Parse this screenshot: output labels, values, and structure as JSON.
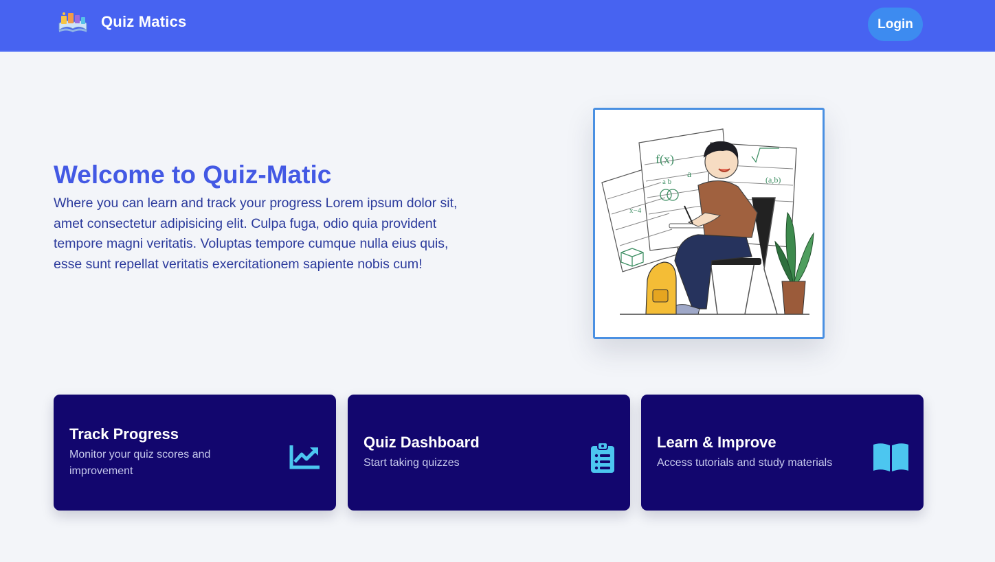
{
  "navbar": {
    "brand_name": "Quiz Matics",
    "login_label": "Login"
  },
  "hero": {
    "title": "Welcome to Quiz-Matic",
    "description": "Where you can learn and track your progress Lorem ipsum dolor sit, amet consectetur adipisicing elit. Culpa fuga, odio quia provident tempore magni veritatis. Voluptas tempore cumque nulla eius quis, esse sunt repellat veritatis exercitationem sapiente nobis cum!"
  },
  "cards": [
    {
      "title": "Track Progress",
      "description": "Monitor your quiz scores and improvement",
      "icon": "chart-line-icon"
    },
    {
      "title": "Quiz Dashboard",
      "description": "Start taking quizzes",
      "icon": "clipboard-list-icon"
    },
    {
      "title": "Learn & Improve",
      "description": "Access tutorials and study materials",
      "icon": "open-book-icon"
    }
  ],
  "colors": {
    "navbar": "#4763f1",
    "login_button": "#3d8bf0",
    "accent_title": "#4359e4",
    "card_bg": "#12066e",
    "card_icon": "#4cc6f0",
    "page_bg": "#f3f5f9"
  }
}
